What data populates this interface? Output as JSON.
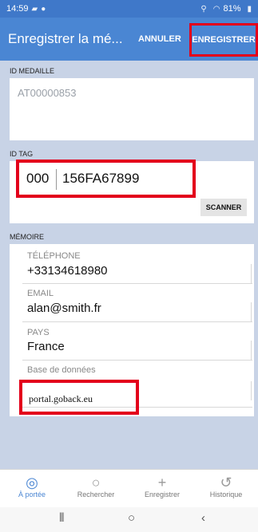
{
  "status": {
    "time": "14:59",
    "battery": "81%"
  },
  "appbar": {
    "title": "Enregistrer la mé...",
    "cancel_label": "ANNULER",
    "save_label": "ENREGISTRER"
  },
  "medal": {
    "label": "ID MEDAILLE",
    "value": "AT00000853"
  },
  "tag": {
    "label": "ID TAG",
    "prefix": "000",
    "value": "156FA67899",
    "scan_label": "SCANNER"
  },
  "memory": {
    "label": "MÉMOIRE",
    "phone_label": "TÉLÉPHONE",
    "phone_value": "+33134618980",
    "email_label": "EMAIL",
    "email_value": "alan@smith.fr",
    "country_label": "PAYS",
    "country_value": "France",
    "db_label": "Base de données",
    "db_value": "portal.goback.eu"
  },
  "nav": {
    "items": [
      {
        "label": "À portée",
        "icon": "radar-icon",
        "active": true
      },
      {
        "label": "Rechercher",
        "icon": "search-icon",
        "active": false
      },
      {
        "label": "Enregistrer",
        "icon": "plus-icon",
        "active": false
      },
      {
        "label": "Historique",
        "icon": "history-icon",
        "active": false
      }
    ]
  },
  "colors": {
    "appbar": "#4a86d3",
    "statusbar": "#3f78c9",
    "background": "#c8d3e6",
    "highlight": "#e3001b"
  }
}
